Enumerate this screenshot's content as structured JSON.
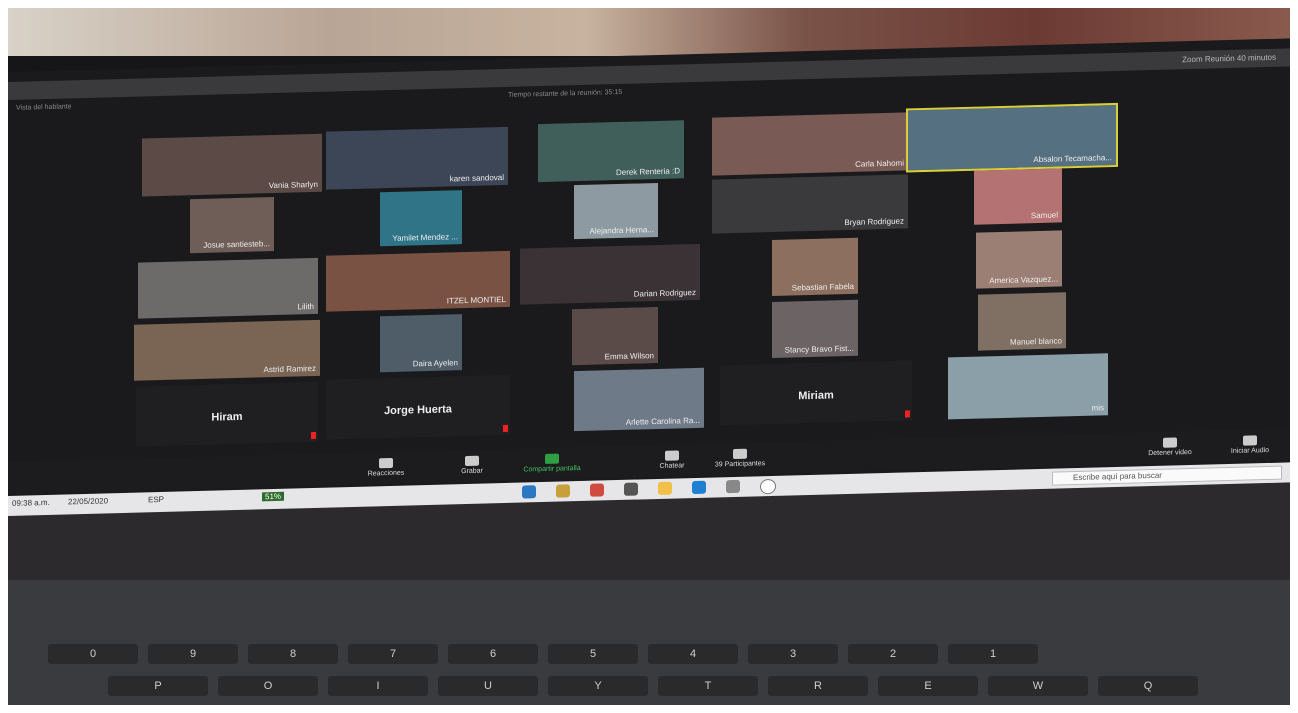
{
  "window": {
    "title": "Zoom Reunión 40 minutos",
    "recording_info": "Tiempo restante de la reunión: 35:15",
    "view_label": "Vista del hablante"
  },
  "participants": [
    {
      "name": "Vania Sharlyn"
    },
    {
      "name": "karen sandoval"
    },
    {
      "name": "Derek Renteria :D"
    },
    {
      "name": "Carla Nahomi"
    },
    {
      "name": "Absalon Tecamacha..."
    },
    {
      "name": "Josue santiesteb..."
    },
    {
      "name": "Yamilet Mendez ..."
    },
    {
      "name": "Alejandra Herna..."
    },
    {
      "name": "Bryan Rodriguez"
    },
    {
      "name": "Samuel"
    },
    {
      "name": "Lilith"
    },
    {
      "name": "ITZEL MONTIEL"
    },
    {
      "name": "Darian Rodriguez"
    },
    {
      "name": "Sebastian Fabela"
    },
    {
      "name": "America Vazquez..."
    },
    {
      "name": "Astrid Ramirez"
    },
    {
      "name": "Daira Ayelen"
    },
    {
      "name": "Emma Wilson"
    },
    {
      "name": "Stancy Bravo Fist..."
    },
    {
      "name": "Manuel blanco"
    },
    {
      "name": "Hiram"
    },
    {
      "name": "Jorge Huerta"
    },
    {
      "name": "Arlette Carolina Ra..."
    },
    {
      "name": "Miriam"
    },
    {
      "name": "mis"
    }
  ],
  "toolbar": {
    "audio": "Iniciar Audio",
    "video": "Detener video",
    "participants": "Participantes",
    "participants_count": "39",
    "chat": "Chatear",
    "share": "Compartir pantalla",
    "record": "Grabar",
    "reactions": "Reacciones"
  },
  "taskbar": {
    "search_placeholder": "Escribe aquí para buscar",
    "time": "09:38 a.m.",
    "date": "22/05/2020",
    "battery": "51%",
    "lang": "ESP"
  },
  "keyboard": {
    "row1": [
      "Q",
      "W",
      "E",
      "R",
      "T",
      "Y",
      "U",
      "I",
      "O",
      "P"
    ],
    "row2": [
      "1",
      "2",
      "3",
      "4",
      "5",
      "6",
      "7",
      "8",
      "9",
      "0"
    ]
  },
  "colors": {
    "active_speaker_border": "#d8d03a",
    "share_button": "#2ea043",
    "muted_icon": "#e22222"
  }
}
